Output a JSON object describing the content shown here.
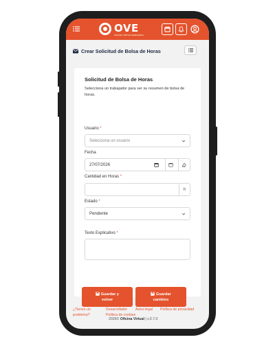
{
  "header": {
    "logo_text": "OVE",
    "logo_sub": "OFICINA VIRTUAL EMPLEADO"
  },
  "page": {
    "title": "Crear Solicitud de Bolsa de Horas"
  },
  "card": {
    "title": "Solicitud de Bolsa de Horas",
    "description": "Selecciona un trabajador para ver su resumen de bolsa de horas."
  },
  "form": {
    "usuario_label": "Usuario",
    "usuario_placeholder": "Selecciona un usuario",
    "fecha_label": "Fecha",
    "fecha_value": "27/07/2026",
    "cantidad_label": "Cantidad en Horas",
    "cantidad_suffix": "h",
    "estado_label": "Estado",
    "estado_value": "Pendiente",
    "texto_label": "Texto Explicativo",
    "required_mark": "*"
  },
  "buttons": {
    "guardar_volver_line1": "Guardar y",
    "guardar_volver_line2": "volver",
    "guardar_cambios_line1": "Guardar",
    "guardar_cambios_line2": "cambios"
  },
  "footer": {
    "problema_line1": "¿Tienes un",
    "problema_line2": "problema?",
    "desarrollador": "Desarrollador",
    "aviso_legal": "Aviso legal",
    "privacidad": "Política de privacidad",
    "cookies": "Política de cookies",
    "copyright": "2026©",
    "product": "Oficina Virtual",
    "version": "| v.3.7.0"
  },
  "colors": {
    "accent": "#e4532d",
    "title_dark": "#1f2a44"
  },
  "icons": [
    "menu-icon",
    "calendar-icon",
    "bell-icon",
    "user-circle-icon",
    "envelope-icon",
    "list-icon",
    "chevron-down-icon",
    "floppy-disk-icon"
  ]
}
